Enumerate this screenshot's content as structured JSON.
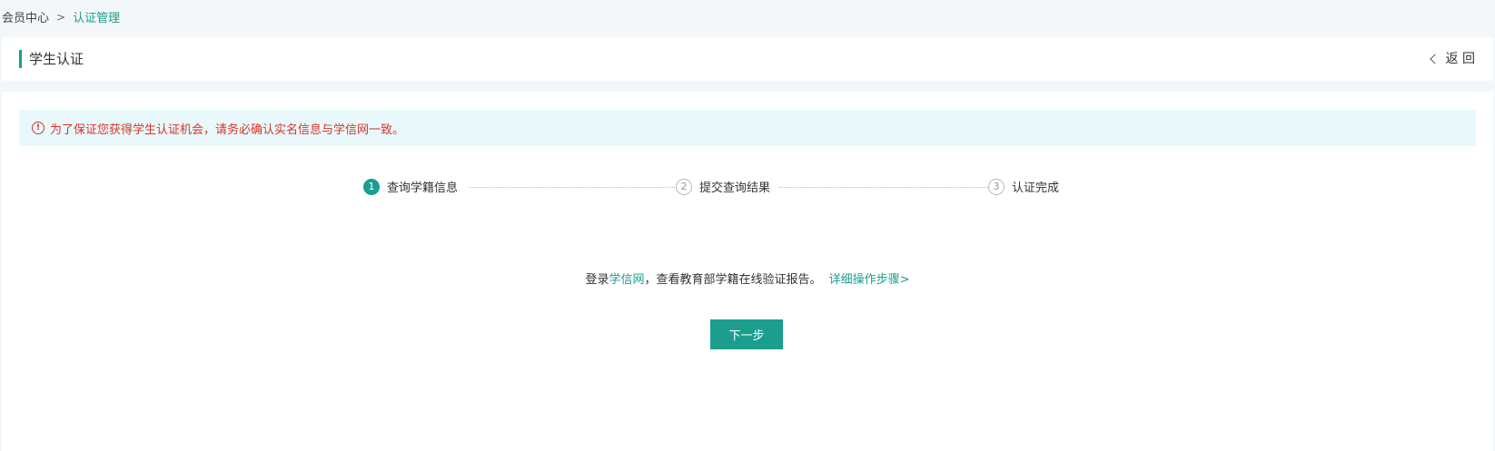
{
  "breadcrumb": {
    "parent": "会员中心",
    "separator": ">",
    "current": "认证管理"
  },
  "header": {
    "title": "学生认证",
    "back_label": "返 回"
  },
  "notice": {
    "icon": "warning-circle-icon",
    "text": "为了保证您获得学生认证机会，请务必确认实名信息与学信网一致。"
  },
  "steps": [
    {
      "number": "1",
      "label": "查询学籍信息",
      "state": "active"
    },
    {
      "number": "2",
      "label": "提交查询结果",
      "state": "inactive"
    },
    {
      "number": "3",
      "label": "认证完成",
      "state": "inactive"
    }
  ],
  "instruction": {
    "prefix": "登录",
    "link_text": "学信网",
    "suffix": "，查看教育部学籍在线验证报告。",
    "detail_link": "详细操作步骤>"
  },
  "next_button": {
    "label": "下一步"
  },
  "colors": {
    "accent": "#1b9e8e",
    "warning": "#d9322b",
    "notice_bg": "#e9f9fb"
  }
}
